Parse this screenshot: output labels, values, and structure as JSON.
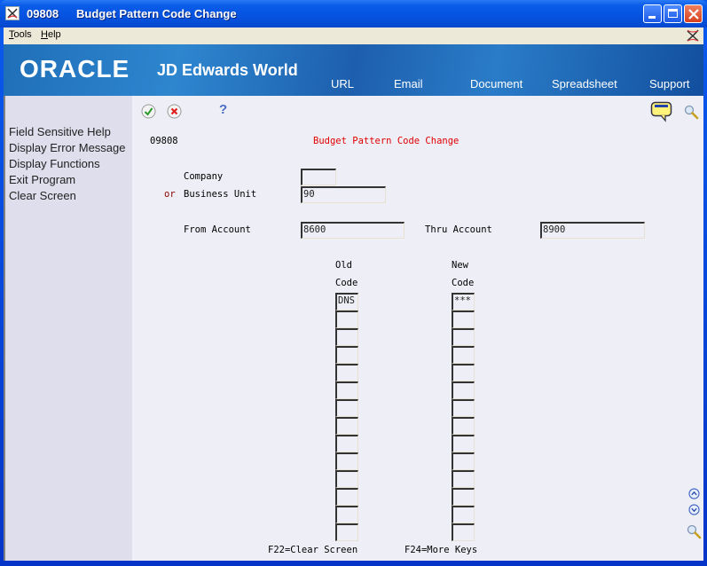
{
  "window": {
    "program_code": "09808",
    "title": "Budget Pattern Code Change"
  },
  "menubar": {
    "items": [
      {
        "label": "Tools",
        "accesskey": "T"
      },
      {
        "label": "Help",
        "accesskey": "H"
      }
    ]
  },
  "banner": {
    "logo_text": "ORACLE",
    "product_text": "JD Edwards World",
    "links": [
      "URL",
      "Email",
      "Document",
      "Spreadsheet",
      "Support"
    ]
  },
  "sidebar": {
    "items": [
      "Field Sensitive Help",
      "Display Error Message",
      "Display Functions",
      "Exit Program",
      "Clear Screen"
    ]
  },
  "toolbar": {
    "icons": [
      "ok-icon",
      "cancel-icon",
      "help-icon"
    ]
  },
  "form": {
    "program_id": "09808",
    "heading": "Budget Pattern Code Change",
    "company_label": "Company",
    "company_value": "",
    "or_label": "or",
    "business_unit_label": "Business Unit",
    "business_unit_value": "90",
    "from_account_label": "From Account",
    "from_account_value": "8600",
    "thru_account_label": "Thru Account",
    "thru_account_value": "8900",
    "old_code_header_1": "Old",
    "old_code_header_2": "Code",
    "new_code_header_1": "New",
    "new_code_header_2": "Code",
    "old_codes": [
      "DNS",
      "",
      "",
      "",
      "",
      "",
      "",
      "",
      "",
      "",
      "",
      "",
      "",
      ""
    ],
    "new_codes": [
      "***",
      "",
      "",
      "",
      "",
      "",
      "",
      "",
      "",
      "",
      "",
      "",
      "",
      ""
    ],
    "f22_label": "F22=Clear Screen",
    "f24_label": "F24=More Keys"
  }
}
